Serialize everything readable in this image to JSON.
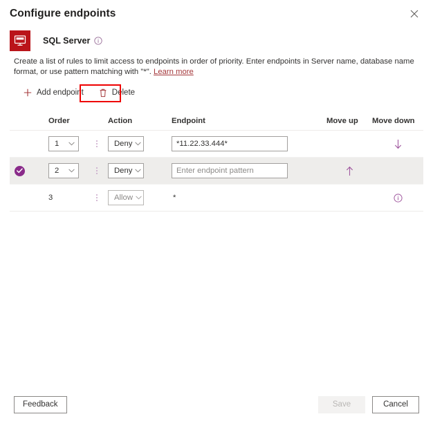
{
  "panel": {
    "title": "Configure endpoints",
    "close_icon": "close-icon"
  },
  "resource": {
    "icon_label": "SQL",
    "name": "SQL Server",
    "info_icon": "info-icon"
  },
  "description": {
    "text_before_link": "Create a list of rules to limit access to endpoints in order of priority. Enter endpoints in Server name, database name format, or use pattern matching with \"*\". ",
    "link_label": "Learn more"
  },
  "commandbar": {
    "add_label": "Add endpoint",
    "add_icon": "plus-icon",
    "delete_label": "Delete",
    "delete_icon": "trash-icon",
    "highlight_color": "#ee0000"
  },
  "table": {
    "headers": {
      "order": "Order",
      "action": "Action",
      "endpoint": "Endpoint",
      "move_up": "Move up",
      "move_down": "Move down"
    },
    "rows": [
      {
        "selected": false,
        "order": "1",
        "order_is_select": true,
        "action": "Deny",
        "action_is_select": true,
        "action_disabled": false,
        "endpoint_value": "*11.22.33.444*",
        "endpoint_placeholder": "",
        "endpoint_is_input": true,
        "move_up": false,
        "move_down": true,
        "info": false
      },
      {
        "selected": true,
        "order": "2",
        "order_is_select": true,
        "action": "Deny",
        "action_is_select": true,
        "action_disabled": false,
        "endpoint_value": "",
        "endpoint_placeholder": "Enter endpoint pattern",
        "endpoint_is_input": true,
        "move_up": true,
        "move_down": false,
        "info": false
      },
      {
        "selected": false,
        "order": "3",
        "order_is_select": false,
        "action": "Allow",
        "action_is_select": true,
        "action_disabled": true,
        "endpoint_value": "*",
        "endpoint_placeholder": "",
        "endpoint_is_input": false,
        "move_up": false,
        "move_down": false,
        "info": true
      }
    ]
  },
  "footer": {
    "feedback_label": "Feedback",
    "save_label": "Save",
    "save_disabled": true,
    "cancel_label": "Cancel"
  },
  "colors": {
    "accent_red": "#a4373a",
    "resource_icon_bg": "#ba141a",
    "arrow_purple": "#a0589f",
    "check_purple": "#8a2b8a"
  }
}
